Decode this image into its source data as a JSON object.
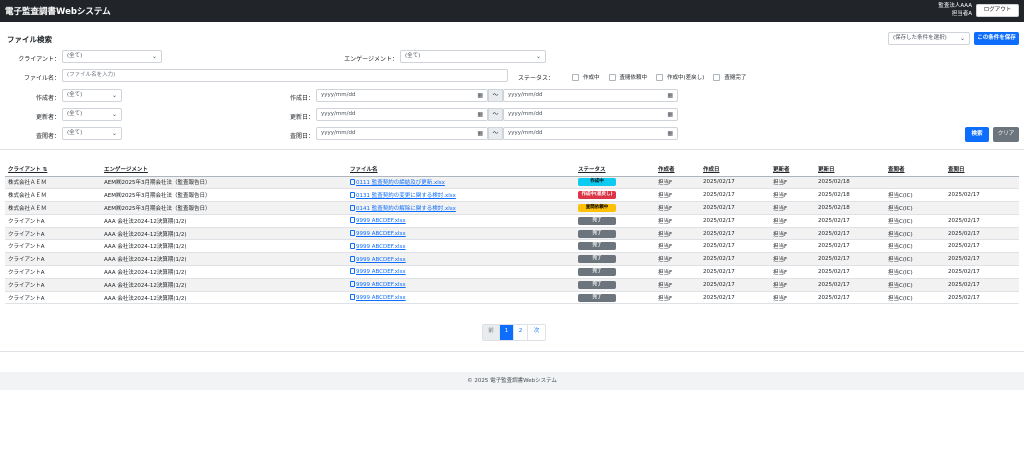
{
  "navbar": {
    "brand": "電子監査調書Webシステム",
    "user_org": "監査法人AAA",
    "user_name": "担当者A",
    "logout_label": "ログアウト"
  },
  "search": {
    "title": "ファイル検索",
    "saved_condition_placeholder": "(保存した条件を選択)",
    "save_condition_label": "この条件を保存",
    "client_label": "クライアント：",
    "client_value": "(全て)",
    "engagement_label": "エンゲージメント：",
    "engagement_value": "(全て)",
    "filename_label": "ファイル名：",
    "filename_placeholder": "(ファイル名を入力)",
    "status_label": "ステータス：",
    "status_options": [
      "作成中",
      "査閲依頼中",
      "作成中(差戻し)",
      "査閲完了"
    ],
    "creator_label": "作成者：",
    "creator_value": "(全て)",
    "created_date_label": "作成日：",
    "updater_label": "更新者：",
    "updater_value": "(全て)",
    "updated_date_label": "更新日：",
    "reviewer_label": "査閲者：",
    "reviewer_value": "(全て)",
    "reviewed_date_label": "査閲日：",
    "date_placeholder": "yyyy/mm/dd",
    "tilde": "〜",
    "search_label": "検索",
    "clear_label": "クリア"
  },
  "table": {
    "headers": [
      "クライアント ⇅",
      "エンゲージメント",
      "ファイル名",
      "ステータス",
      "作成者",
      "作成日",
      "更新者",
      "更新日",
      "査閲者",
      "査閲日"
    ],
    "rows": [
      {
        "client": "株式会社ＡＥＭ",
        "engagement": "AEM㈱2025年3月期会社法（監査報告日）",
        "file": "0111 監査契約の締結及び更新.xlsx",
        "status": "作成中",
        "status_color": "#0dcaf0",
        "status_text_color": "#000000",
        "creator": "担当F",
        "created": "2025/02/17",
        "updater": "担当F",
        "updated": "2025/02/18",
        "reviewer": "",
        "reviewed": ""
      },
      {
        "client": "株式会社ＡＥＭ",
        "engagement": "AEM㈱2025年3月期会社法（監査報告日）",
        "file": "0131 監査契約の変更に関する検討.xlsx",
        "status": "作成中(差戻し)",
        "status_color": "#dc3545",
        "status_text_color": "#ffffff",
        "creator": "担当F",
        "created": "2025/02/17",
        "updater": "担当F",
        "updated": "2025/02/18",
        "reviewer": "担当C(IC)",
        "reviewed": "2025/02/17"
      },
      {
        "client": "株式会社ＡＥＭ",
        "engagement": "AEM㈱2025年3月期会社法（監査報告日）",
        "file": "0141 監査契約の解除に関する検討.xlsx",
        "status": "査閲依頼中",
        "status_color": "#ffc107",
        "status_text_color": "#000000",
        "creator": "担当F",
        "created": "2025/02/17",
        "updater": "担当F",
        "updated": "2025/02/18",
        "reviewer": "担当C(IC)",
        "reviewed": ""
      },
      {
        "client": "クライアントA",
        "engagement": "AAA 会社法2024-12決算期(1/2)",
        "file": "9999 ABCDEF.xlsx",
        "status": "完了",
        "status_color": "#6c757d",
        "status_text_color": "#ffffff",
        "creator": "担当F",
        "created": "2025/02/17",
        "updater": "担当F",
        "updated": "2025/02/17",
        "reviewer": "担当C(IC)",
        "reviewed": "2025/02/17"
      },
      {
        "client": "クライアントA",
        "engagement": "AAA 会社法2024-12決算期(1/2)",
        "file": "9999 ABCDEF.xlsx",
        "status": "完了",
        "status_color": "#6c757d",
        "status_text_color": "#ffffff",
        "creator": "担当F",
        "created": "2025/02/17",
        "updater": "担当F",
        "updated": "2025/02/17",
        "reviewer": "担当C(IC)",
        "reviewed": "2025/02/17"
      },
      {
        "client": "クライアントA",
        "engagement": "AAA 会社法2024-12決算期(1/2)",
        "file": "9999 ABCDEF.xlsx",
        "status": "完了",
        "status_color": "#6c757d",
        "status_text_color": "#ffffff",
        "creator": "担当F",
        "created": "2025/02/17",
        "updater": "担当F",
        "updated": "2025/02/17",
        "reviewer": "担当C(IC)",
        "reviewed": "2025/02/17"
      },
      {
        "client": "クライアントA",
        "engagement": "AAA 会社法2024-12決算期(1/2)",
        "file": "9999 ABCDEF.xlsx",
        "status": "完了",
        "status_color": "#6c757d",
        "status_text_color": "#ffffff",
        "creator": "担当F",
        "created": "2025/02/17",
        "updater": "担当F",
        "updated": "2025/02/17",
        "reviewer": "担当C(IC)",
        "reviewed": "2025/02/17"
      },
      {
        "client": "クライアントA",
        "engagement": "AAA 会社法2024-12決算期(1/2)",
        "file": "9999 ABCDEF.xlsx",
        "status": "完了",
        "status_color": "#6c757d",
        "status_text_color": "#ffffff",
        "creator": "担当F",
        "created": "2025/02/17",
        "updater": "担当F",
        "updated": "2025/02/17",
        "reviewer": "担当C(IC)",
        "reviewed": "2025/02/17"
      },
      {
        "client": "クライアントA",
        "engagement": "AAA 会社法2024-12決算期(1/2)",
        "file": "9999 ABCDEF.xlsx",
        "status": "完了",
        "status_color": "#6c757d",
        "status_text_color": "#ffffff",
        "creator": "担当F",
        "created": "2025/02/17",
        "updater": "担当F",
        "updated": "2025/02/17",
        "reviewer": "担当C(IC)",
        "reviewed": "2025/02/17"
      },
      {
        "client": "クライアントA",
        "engagement": "AAA 会社法2024-12決算期(1/2)",
        "file": "9999 ABCDEF.xlsx",
        "status": "完了",
        "status_color": "#6c757d",
        "status_text_color": "#ffffff",
        "creator": "担当F",
        "created": "2025/02/17",
        "updater": "担当F",
        "updated": "2025/02/17",
        "reviewer": "担当C(IC)",
        "reviewed": "2025/02/17"
      }
    ]
  },
  "pagination": {
    "prev": "前",
    "pages": [
      "1",
      "2"
    ],
    "next": "次"
  },
  "footer": {
    "text": "© 2025 電子監査調書Webシステム"
  },
  "colors": {
    "primary": "#0d6efd",
    "navbar": "#212529",
    "secondary": "#6c757d"
  }
}
